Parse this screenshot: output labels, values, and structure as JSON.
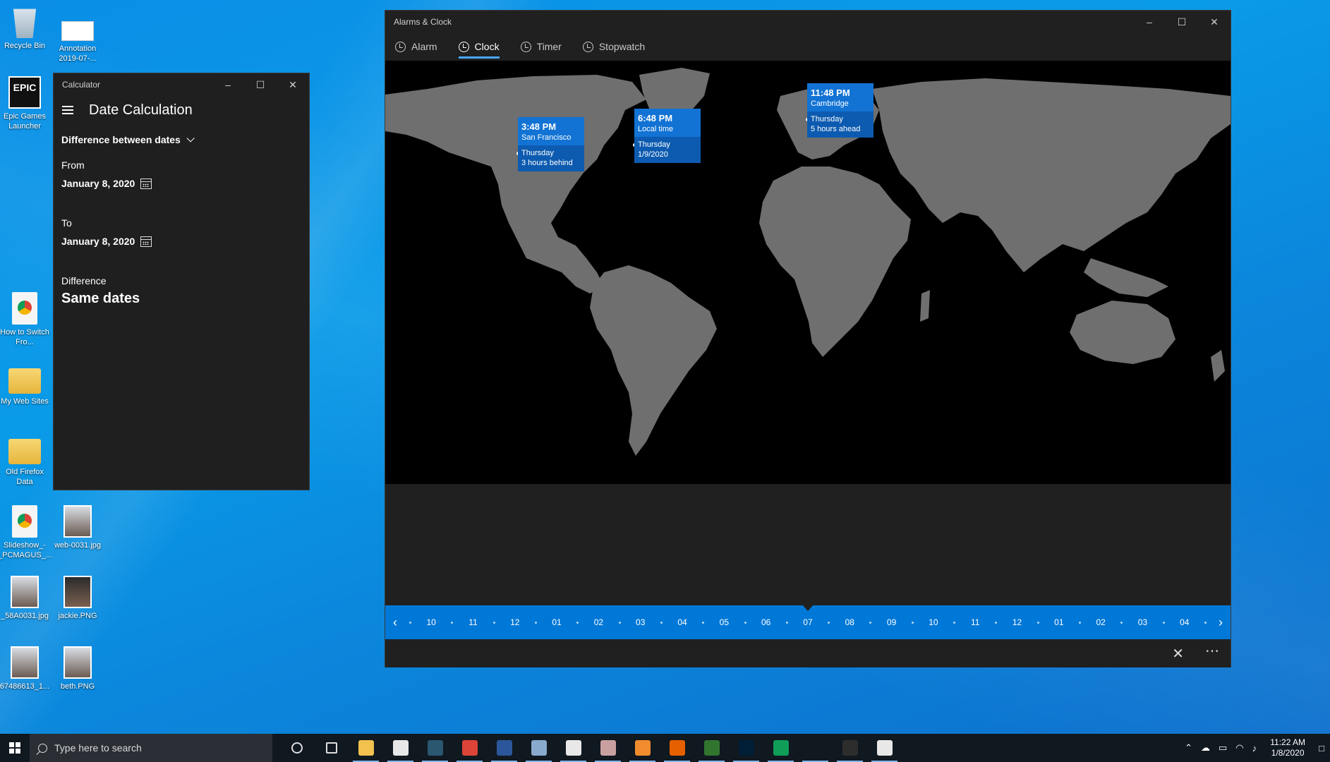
{
  "desktop": {
    "icons": [
      {
        "label": "Recycle Bin",
        "icon": "recycle-bin-icon"
      },
      {
        "label": "Annotation 2019-07-...",
        "icon": "image-file-icon"
      },
      {
        "label": "Epic Games Launcher",
        "icon": "epic-games-icon"
      },
      {
        "label": "How to Switch Fro...",
        "icon": "chrome-document-icon"
      },
      {
        "label": "My Web Sites",
        "icon": "folder-icon"
      },
      {
        "label": "Old Firefox Data",
        "icon": "folder-icon"
      },
      {
        "label": "Slideshow_-_PCMAGUS_...",
        "icon": "chrome-document-icon"
      },
      {
        "label": "web-0031.jpg",
        "icon": "photo-icon"
      },
      {
        "label": "_58A0031.jpg",
        "icon": "photo-icon"
      },
      {
        "label": "jackie.PNG",
        "icon": "photo-icon"
      },
      {
        "label": "67486613_1...",
        "icon": "photo-icon"
      },
      {
        "label": "beth.PNG",
        "icon": "photo-icon"
      }
    ]
  },
  "calculator": {
    "window_title": "Calculator",
    "mode_title": "Date Calculation",
    "calc_type": "Difference between dates",
    "from_label": "From",
    "from_date": "January 8, 2020",
    "to_label": "To",
    "to_date": "January 8, 2020",
    "difference_label": "Difference",
    "difference_value": "Same dates"
  },
  "alarms": {
    "window_title": "Alarms & Clock",
    "tabs": [
      {
        "label": "Alarm",
        "active": false
      },
      {
        "label": "Clock",
        "active": true
      },
      {
        "label": "Timer",
        "active": false
      },
      {
        "label": "Stopwatch",
        "active": false
      }
    ],
    "clocks": [
      {
        "time": "3:48 PM",
        "place": "San Francisco",
        "day": "Thursday",
        "offset": "3 hours behind"
      },
      {
        "time": "6:48 PM",
        "place": "Local time",
        "day": "Thursday",
        "offset": "1/9/2020"
      },
      {
        "time": "11:48 PM",
        "place": "Cambridge",
        "day": "Thursday",
        "offset": "5 hours ahead"
      }
    ],
    "timeline_hours": [
      "10",
      "11",
      "12",
      "01",
      "02",
      "03",
      "04",
      "05",
      "06",
      "07",
      "08",
      "09",
      "10",
      "11",
      "12",
      "01",
      "02",
      "03",
      "04"
    ],
    "accent": "#0078d7"
  },
  "taskbar": {
    "search_placeholder": "Type here to search",
    "apps": [
      {
        "name": "cortana-icon",
        "color": "#101820"
      },
      {
        "name": "task-view-icon",
        "color": "#101820"
      },
      {
        "name": "file-explorer-icon",
        "color": "#f2c14e"
      },
      {
        "name": "store-icon",
        "color": "#e8e8e8"
      },
      {
        "name": "app-icon",
        "color": "#2b5770"
      },
      {
        "name": "chrome-icon",
        "color": "#db4437"
      },
      {
        "name": "word-icon",
        "color": "#2b579a"
      },
      {
        "name": "paint-icon",
        "color": "#88aacc"
      },
      {
        "name": "slack-icon",
        "color": "#e8e8e8"
      },
      {
        "name": "app-icon",
        "color": "#c9a0a0"
      },
      {
        "name": "app-icon",
        "color": "#f08c2e"
      },
      {
        "name": "firefox-icon",
        "color": "#e66000"
      },
      {
        "name": "project-icon",
        "color": "#31752f"
      },
      {
        "name": "photoshop-icon",
        "color": "#001e36"
      },
      {
        "name": "chrome-icon",
        "color": "#0f9d58"
      },
      {
        "name": "alarms-icon",
        "color": "#101820"
      },
      {
        "name": "calculator-icon",
        "color": "#2d2d2d"
      },
      {
        "name": "maps-icon",
        "color": "#e8e8e8"
      }
    ],
    "time": "11:22 AM",
    "date": "1/8/2020"
  }
}
